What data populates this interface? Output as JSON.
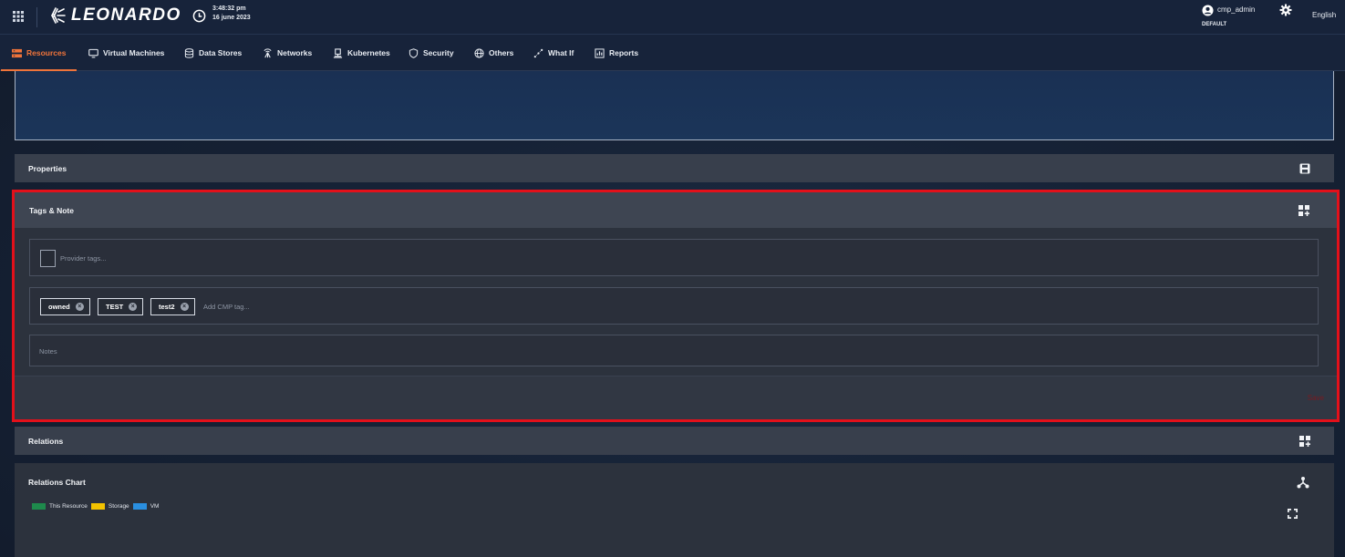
{
  "header": {
    "brand": "LEONARDO",
    "time": "3:48:32 pm",
    "date": "16 june 2023",
    "user": "cmp_admin",
    "tenant": "DEFAULT",
    "language": "English"
  },
  "nav": {
    "items": [
      {
        "label": "Resources",
        "icon": "resources-icon",
        "active": true
      },
      {
        "label": "Virtual Machines",
        "icon": "monitor-icon"
      },
      {
        "label": "Data Stores",
        "icon": "database-icon"
      },
      {
        "label": "Networks",
        "icon": "network-icon"
      },
      {
        "label": "Kubernetes",
        "icon": "kubernetes-icon"
      },
      {
        "label": "Security",
        "icon": "shield-icon"
      },
      {
        "label": "Others",
        "icon": "globe-icon"
      },
      {
        "label": "What If",
        "icon": "what-if-icon"
      },
      {
        "label": "Reports",
        "icon": "reports-icon"
      }
    ]
  },
  "properties": {
    "title": "Properties"
  },
  "tags_note": {
    "title": "Tags & Note",
    "provider_placeholder": "Provider tags...",
    "cmp_tags": [
      "owned",
      "TEST",
      "test2"
    ],
    "cmp_placeholder": "Add CMP tag...",
    "notes_placeholder": "Notes",
    "save_label": "Save"
  },
  "relations": {
    "title": "Relations"
  },
  "relations_chart": {
    "title": "Relations Chart",
    "legend": [
      {
        "label": "This Resource",
        "color": "#1e8a4c"
      },
      {
        "label": "Storage",
        "color": "#f2c200"
      },
      {
        "label": "VM",
        "color": "#2a8fe0"
      }
    ]
  },
  "colors": {
    "accent": "#f0743a",
    "highlight_border": "#e3101a"
  }
}
